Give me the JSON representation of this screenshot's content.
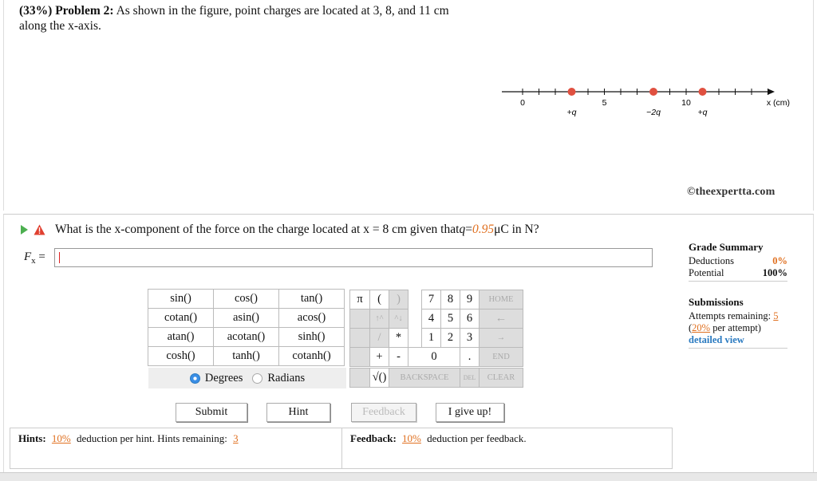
{
  "problem": {
    "percent": "(33%)",
    "label": "Problem 2:",
    "text": "As shown in the figure, point charges are located at 3, 8, and 11 cm along the x-axis."
  },
  "figure": {
    "axis_ticks": [
      "0",
      "5",
      "10"
    ],
    "axis_label": "x (cm)",
    "charges": [
      {
        "position": 3,
        "label": "+q"
      },
      {
        "position": 8,
        "label": "−2q"
      },
      {
        "position": 11,
        "label": "+q"
      }
    ],
    "colors": {
      "axis": "#111111",
      "charge": "#e05040"
    },
    "credit": "©theexpertta.com"
  },
  "question": {
    "prefix": "What is the x-component of the force on the charge located at x = 8 cm given that ",
    "q_symbol": "q",
    "eq": " = ",
    "q_value": "0.95",
    "suffix": " μC in N?",
    "answer_label": "F",
    "answer_sub": "x",
    "answer_eq": " =",
    "answer_value": ""
  },
  "grade": {
    "title": "Grade Summary",
    "deductions_label": "Deductions",
    "deductions_value": "0%",
    "potential_label": "Potential",
    "potential_value": "100%",
    "submissions_title": "Submissions",
    "attempts_label": "Attempts remaining: ",
    "attempts_value": "5",
    "per_attempt_pct": "20%",
    "per_attempt_text": " per attempt)",
    "open_paren": "(",
    "detailed_view": "detailed view"
  },
  "calculator": {
    "functions": [
      "sin()",
      "cos()",
      "tan()",
      "cotan()",
      "asin()",
      "acos()",
      "atan()",
      "acotan()",
      "sinh()",
      "cosh()",
      "tanh()",
      "cotanh()"
    ],
    "degrees_label": "Degrees",
    "radians_label": "Radians",
    "keys": {
      "pi": "π",
      "lparen": "(",
      "rparen": ")",
      "d7": "7",
      "d8": "8",
      "d9": "9",
      "home": "HOME",
      "up": "↑^",
      "down": "^↓",
      "d4": "4",
      "d5": "5",
      "d6": "6",
      "left": "←",
      "slash": "/",
      "star": "*",
      "d1": "1",
      "d2": "2",
      "d3": "3",
      "right": "→",
      "plus": "+",
      "minus": "-",
      "d0": "0",
      "dot": ".",
      "end": "END",
      "sqrt": "√()",
      "backspace": "BACKSPACE",
      "del": "DEL",
      "clear": "CLEAR"
    }
  },
  "buttons": {
    "submit": "Submit",
    "hint": "Hint",
    "feedback": "Feedback",
    "give_up": "I give up!"
  },
  "hints": {
    "label": "Hints:",
    "pct": "10%",
    "text": " deduction per hint. Hints remaining: ",
    "remaining": "3"
  },
  "feedback": {
    "label": "Feedback:",
    "pct": "10%",
    "text": " deduction per feedback."
  }
}
